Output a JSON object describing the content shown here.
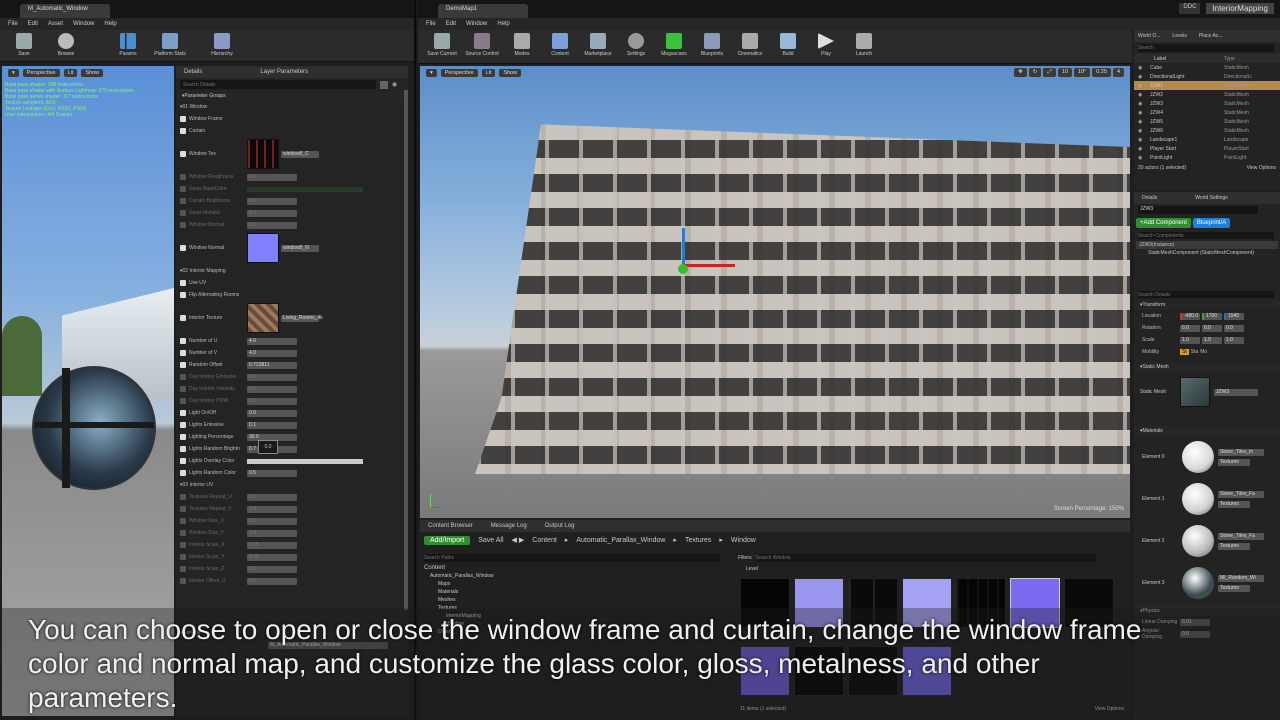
{
  "left_window": {
    "tab": "M_Automatic_Window",
    "menu": [
      "File",
      "Edit",
      "Asset",
      "Window",
      "Help"
    ],
    "toolbar": [
      "Save",
      "Browse",
      "Params",
      "Platform Stats",
      "Hierarchy"
    ],
    "viewport_buttons": [
      "Perspective",
      "Lit",
      "Show"
    ],
    "stats_lines": [
      "Base pass shader: 349 instructions",
      "Base pass shader with Surface Lightmap: 376 instructions",
      "Base pass vertex shader: 117 instructions",
      "Texture samplers: 8/16",
      "Texture Lookups (Est.): VS(0), PS(9)",
      "User interpolators: 4/4 Scalars"
    ],
    "details_tabs": [
      "Details",
      "Layer Parameters"
    ],
    "search_placeholder": "Search Details",
    "parameter_groups": "Parameter Groups",
    "group1": "01 Window",
    "group1_params": [
      {
        "label": "Window Frame",
        "on": true
      },
      {
        "label": "Curtain",
        "on": true
      },
      {
        "label": "Window Tex",
        "on": true,
        "value": "window5_C"
      },
      {
        "label": "Window Roughness",
        "on": false,
        "value": "0.0"
      },
      {
        "label": "Glass BaseColor",
        "on": false
      },
      {
        "label": "Curtain Brightness",
        "on": false,
        "value": "0.4"
      },
      {
        "label": "Glass Metallic",
        "on": false,
        "value": "0.7"
      },
      {
        "label": "Window Normal",
        "on": false,
        "value": "1.0"
      },
      {
        "label": "Window Normal",
        "on": true,
        "value": "window5_N"
      }
    ],
    "group2": "02 Interior Mapping",
    "group2_params": [
      {
        "label": "Use UV",
        "on": true
      },
      {
        "label": "Flip Alternating Rooms",
        "on": true
      },
      {
        "label": "Interior Texture",
        "on": true,
        "value": "Living_Rooms_4k"
      },
      {
        "label": "Number of U",
        "on": true,
        "value": "4.0"
      },
      {
        "label": "Number of V",
        "on": true,
        "value": "4.0"
      },
      {
        "label": "Random Offset",
        "on": true,
        "value": "0.723811"
      },
      {
        "label": "Day Interior Emissive",
        "on": false,
        "value": "0.0"
      },
      {
        "label": "Day Interior Intensity",
        "on": false,
        "value": "0.0"
      },
      {
        "label": "Day Interior POW",
        "on": false,
        "value": "1.0"
      },
      {
        "label": "Light On/Off",
        "on": true,
        "value": "0.0"
      },
      {
        "label": "Lights Emissive",
        "on": true,
        "value": "0.1"
      },
      {
        "label": "Lighting Percentage",
        "on": true,
        "value": "30.0"
      },
      {
        "label": "Lights Random Brightn",
        "on": true,
        "value": "0.7"
      },
      {
        "label": "Lights Overlay Color",
        "on": true
      },
      {
        "label": "Lights Random Color",
        "on": true,
        "value": "0.5"
      }
    ],
    "tooltip_value": "0.0",
    "group3": "03 Interior UV",
    "group3_params": [
      {
        "label": "Textures Repeat_U",
        "value": "1.0"
      },
      {
        "label": "Textures Repeat_V",
        "value": "1.0"
      },
      {
        "label": "Window Size_X",
        "value": "2.0"
      },
      {
        "label": "Window Size_Y",
        "value": "2.0"
      },
      {
        "label": "Interior Scale_X",
        "value": "0.75"
      },
      {
        "label": "Interior Scale_Y",
        "value": "0.75"
      },
      {
        "label": "Interior Scale_Z",
        "value": "1.0"
      },
      {
        "label": "Interior Offset_U",
        "value": "0.0"
      }
    ],
    "general": "General",
    "parent_value": "M_Automatic_Parallax_Window"
  },
  "main_window": {
    "tab": "DemoMap1",
    "menu": [
      "File",
      "Edit",
      "Window",
      "Help"
    ],
    "toolbar": [
      "Save Current",
      "Source Control",
      "Modes",
      "Content",
      "Marketplace",
      "Settings",
      "Megascans",
      "Blueprints",
      "Cinematics",
      "Build",
      "Play",
      "Launch"
    ],
    "top_right": [
      "DDC",
      "InteriorMapping"
    ],
    "viewport_buttons": [
      "Perspective",
      "Lit",
      "Show"
    ],
    "snap_values": [
      "10",
      "10°",
      "0.25",
      "4"
    ],
    "screen_percentage": "Screen Percentage: 150%",
    "content_tabs": [
      "Content Browser",
      "Message Log",
      "Output Log"
    ],
    "add_import": "Add/Import",
    "save_all": "Save All",
    "breadcrumb": [
      "Content",
      "Automatic_Parallax_Window",
      "Textures",
      "Window"
    ],
    "search_paths": "Search Paths",
    "filters": "Filters",
    "search_window": "Search Window",
    "level_label": "Level",
    "tree": [
      "Content",
      "Automatic_Parallax_Window",
      "Maps",
      "Materials",
      "Meshes",
      "Textures",
      "InteriorMapping",
      "Window",
      "Other"
    ],
    "items_count": "11 items (1 selected)",
    "view_options": "View Options"
  },
  "outliner": {
    "tabs": [
      "World O...",
      "Levels",
      "Place Ac..."
    ],
    "search_placeholder": "Search",
    "col_label": "Label",
    "col_type": "Type",
    "rows": [
      {
        "label": "Cube",
        "type": "StaticMesh"
      },
      {
        "label": "DirectionalLight",
        "type": "DirectionalLi"
      },
      {
        "label": "JZW1",
        "type": "StaticMesh"
      },
      {
        "label": "JZW2",
        "type": "StaticMesh"
      },
      {
        "label": "JZW3",
        "type": "StaticMesh"
      },
      {
        "label": "JZW4",
        "type": "StaticMesh"
      },
      {
        "label": "JZW5",
        "type": "StaticMesh"
      },
      {
        "label": "JZW6",
        "type": "StaticMesh"
      },
      {
        "label": "Landscape1",
        "type": "Landscape"
      },
      {
        "label": "Player Start",
        "type": "PlayerStart"
      },
      {
        "label": "PointLight",
        "type": "PointLight"
      },
      {
        "label": "PointLight2",
        "type": "PointLight"
      },
      {
        "label": "PointLight3",
        "type": "PointLight"
      }
    ],
    "selected_index": 2,
    "actor_count": "20 actors (1 selected)",
    "view_options": "View Options"
  },
  "details": {
    "tabs": [
      "Details",
      "World Settings"
    ],
    "name": "JZW3",
    "add_component": "+Add Component",
    "blueprint": "Blueprint/A",
    "search_components": "Search Components",
    "instance": "JZW3(Instance)",
    "component": "StaticMeshComponent (StaticMeshComponent)",
    "search_details": "Search Details",
    "transform": "Transform",
    "location_label": "Location",
    "location": [
      "-480.0",
      "1700",
      "1540"
    ],
    "rotation_label": "Rotation",
    "rotation": [
      "0.0",
      "0.0",
      "0.0"
    ],
    "scale_label": "Scale",
    "scale": [
      "1.0",
      "1.0",
      "1.0"
    ],
    "mobility_label": "Mobility",
    "mobility": [
      "St",
      "Sta",
      "Mo"
    ],
    "static_mesh_section": "Static Mesh",
    "static_mesh_label": "Static Mesh",
    "static_mesh_value": "JZW3",
    "materials_section": "Materials",
    "materials": [
      {
        "element": "Element 0",
        "name": "Stone_Tiles_In",
        "slot": "Textures"
      },
      {
        "element": "Element 1",
        "name": "Stone_Tiles_Fa",
        "slot": "Textures"
      },
      {
        "element": "Element 2",
        "name": "Stone_Tiles_Fa",
        "slot": "Textures"
      },
      {
        "element": "Element 3",
        "name": "MI_Random_Wi",
        "slot": "Textures"
      }
    ],
    "physics": "Physics",
    "linear_damping": "Linear Damping",
    "linear_damping_value": "0.01",
    "angular_damping": "Angular Damping",
    "angular_damping_value": "0.0"
  },
  "subtitle": {
    "line1": "You can choose to open or close the window frame and curtain, change the window frame",
    "line2": "color and normal map, and customize the glass color, gloss, metalness, and other",
    "line3": "parameters."
  },
  "colors": {
    "accent": "#2f8f2f",
    "selection": "#3f6fbf",
    "blue": "#1a80e0",
    "normal_map": "#8080ff"
  }
}
